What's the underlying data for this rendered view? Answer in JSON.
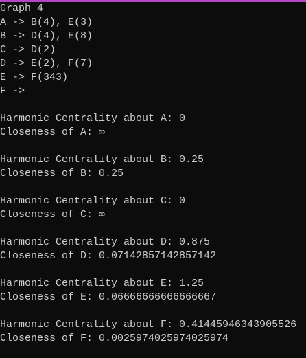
{
  "accent_color": "#b446c3",
  "lines": [
    "Graph 4",
    "A -> B(4), E(3)",
    "B -> D(4), E(8)",
    "C -> D(2)",
    "D -> E(2), F(7)",
    "E -> F(343)",
    "F ->",
    "",
    "Harmonic Centrality about A: 0",
    "Closeness of A: ∞",
    "",
    "Harmonic Centrality about B: 0.25",
    "Closeness of B: 0.25",
    "",
    "Harmonic Centrality about C: 0",
    "Closeness of C: ∞",
    "",
    "Harmonic Centrality about D: 0.875",
    "Closeness of D: 0.07142857142857142",
    "",
    "Harmonic Centrality about E: 1.25",
    "Closeness of E: 0.06666666666666667",
    "",
    "Harmonic Centrality about F: 0.41445946343905526",
    "Closeness of F: 0.0025974025974025974"
  ]
}
